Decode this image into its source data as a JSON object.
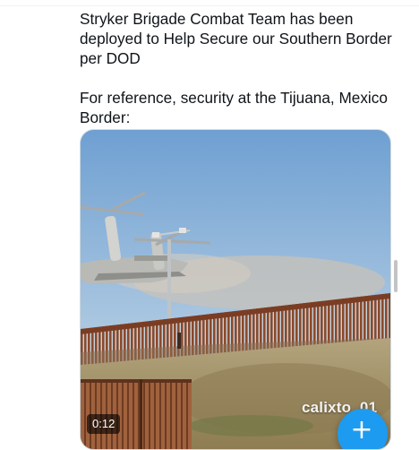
{
  "tweet": {
    "line1": "Stryker Brigade Combat Team has been deployed to Help Secure our Southern Border per DOD",
    "line2": "For reference, security at the Tijuana, Mexico Border:"
  },
  "video": {
    "duration": "0:12",
    "watermark": "calixto_01",
    "compose_icon": "plus-icon",
    "compose_symbol": "+"
  }
}
